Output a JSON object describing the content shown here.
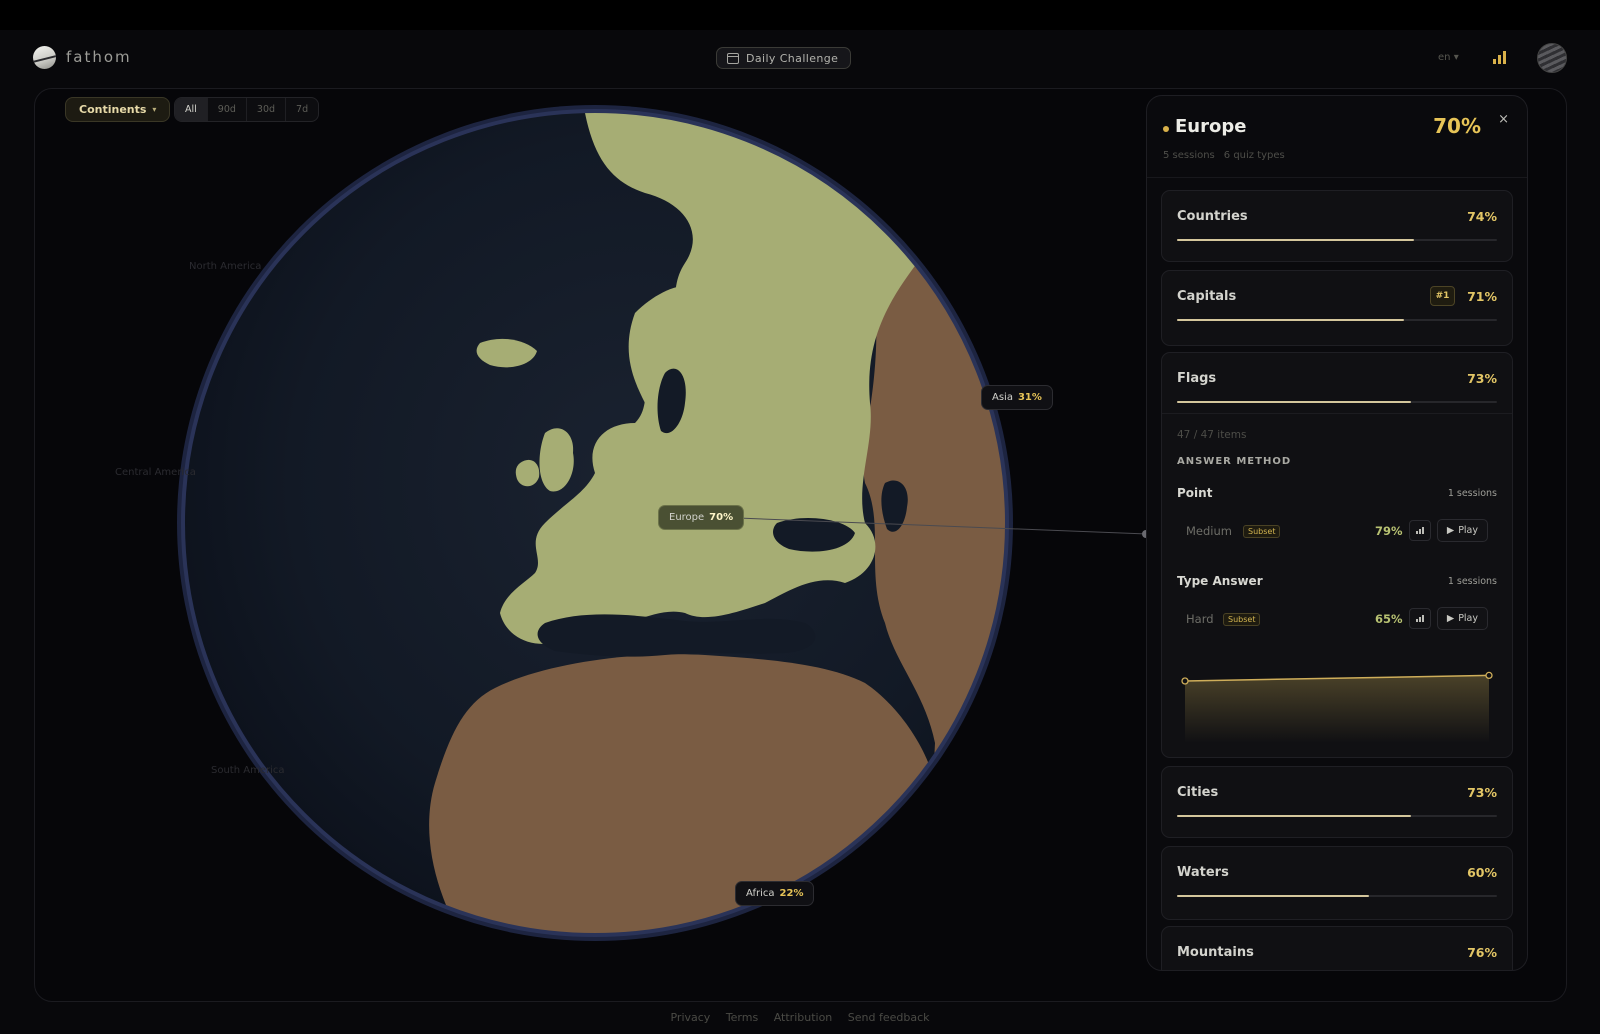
{
  "header": {
    "brand": "fathom",
    "daily_challenge": "Daily Challenge",
    "language": "en",
    "language_caret": "▾"
  },
  "filters": {
    "continents": "Continents",
    "continents_caret": "▾",
    "ranges": [
      "All",
      "90d",
      "30d",
      "7d"
    ],
    "active_range": "All"
  },
  "globe": {
    "faint_labels": [
      "North America",
      "Central America",
      "South America"
    ],
    "callouts": {
      "europe": {
        "name": "Europe",
        "pct": "70%"
      },
      "asia": {
        "name": "Asia",
        "pct": "31%"
      },
      "africa": {
        "name": "Africa",
        "pct": "22%"
      }
    },
    "colors": {
      "europe": "#a6ad74",
      "other_land": "#7a5c43",
      "ocean": "#131a26",
      "rim": "#2a3358"
    }
  },
  "panel": {
    "title": "Europe",
    "pct": "70%",
    "close": "×",
    "sessions": "5 sessions",
    "quiz_types": "6 quiz types",
    "categories": [
      {
        "name": "Countries",
        "pct": "74%",
        "progress": 74
      },
      {
        "name": "Capitals",
        "pct": "71%",
        "progress": 71,
        "rank": "#1"
      },
      {
        "name": "Flags",
        "pct": "73%",
        "progress": 73
      },
      {
        "name": "Cities",
        "pct": "73%",
        "progress": 73
      },
      {
        "name": "Waters",
        "pct": "60%",
        "progress": 60
      },
      {
        "name": "Mountains",
        "pct": "76%",
        "progress": 76
      }
    ],
    "flags_detail": {
      "items": "47 / 47 items",
      "answer_method_heading": "ANSWER METHOD",
      "methods": [
        {
          "name": "Point",
          "sessions": "1 sessions",
          "difficulty": "Medium",
          "tag": "Subset",
          "score": "79%",
          "play": "Play"
        },
        {
          "name": "Type Answer",
          "sessions": "1 sessions",
          "difficulty": "Hard",
          "tag": "Subset",
          "score": "65%",
          "play": "Play"
        }
      ],
      "trend": [
        65,
        79
      ]
    }
  },
  "footer": {
    "links": [
      "Privacy",
      "Terms",
      "Attribution",
      "Send feedback"
    ]
  }
}
